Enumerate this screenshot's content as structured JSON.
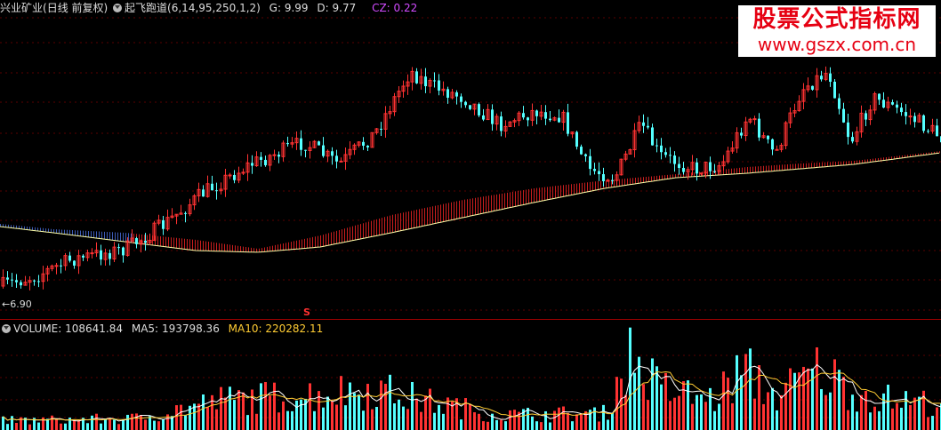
{
  "main_header": {
    "stock": "兴业矿业",
    "period": "(日线 前复权)",
    "indicator": "起飞跑道",
    "params": "(6,14,95,250,1,2)",
    "g_label": "G:",
    "g_value": "9.99",
    "d_label": "D:",
    "d_value": "9.77",
    "cz_label": "CZ:",
    "cz_value": "0.22"
  },
  "volume_header": {
    "volume_label": "VOLUME:",
    "volume_value": "108641.84",
    "ma5_label": "MA5:",
    "ma5_value": "193798.36",
    "ma10_label": "MA10:",
    "ma10_value": "220282.11"
  },
  "watermark": {
    "line1": "股票公式指标网",
    "line2": "www.gszx.com.cn"
  },
  "low_label": "←6.90",
  "signal_marker": "S",
  "colors": {
    "up": "#ff3232",
    "down": "#54ffff",
    "grid": "#5a0000",
    "separator": "#a00000",
    "ma_line": "#ffffaa",
    "runway_up": "#c81e1e",
    "runway_down": "#3c5ab4",
    "cz": "#d24bff",
    "ma10_text": "#ffcc33"
  }
}
